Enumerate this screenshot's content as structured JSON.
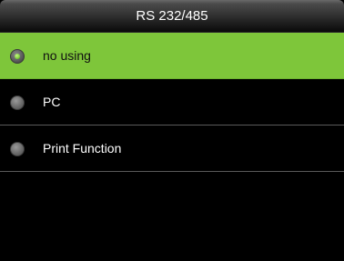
{
  "title_bar": {
    "title": "RS 232/485"
  },
  "options": [
    {
      "label": "no using",
      "selected": true,
      "icon": "radio-selected-icon"
    },
    {
      "label": "PC",
      "selected": false,
      "icon": "radio-unselected-icon"
    },
    {
      "label": "Print Function",
      "selected": false,
      "icon": "radio-unselected-icon"
    }
  ],
  "colors": {
    "selected_background": "#7ec63a",
    "background": "#000000",
    "text": "#ffffff"
  }
}
